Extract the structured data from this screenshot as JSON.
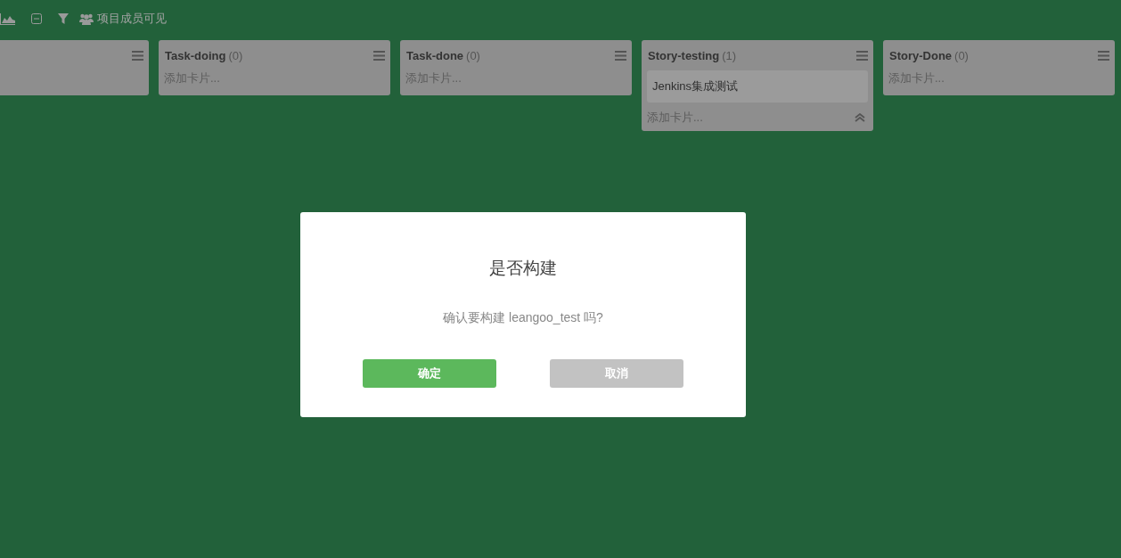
{
  "toolbar": {
    "visibility_label": "项目成员可见"
  },
  "lists": [
    {
      "kind": "cut"
    },
    {
      "kind": "list",
      "title": "Task-doing",
      "count": "(0)",
      "add_card": "添加卡片..."
    },
    {
      "kind": "list",
      "title": "Task-done",
      "count": "(0)",
      "add_card": "添加卡片..."
    },
    {
      "kind": "list",
      "title": "Story-testing",
      "count": "(1)",
      "cards": [
        "Jenkins集成测试"
      ],
      "add_card": "添加卡片...",
      "collapsible": true
    },
    {
      "kind": "list",
      "title": "Story-Done",
      "count": "(0)",
      "add_card": "添加卡片..."
    }
  ],
  "dialog": {
    "title": "是否构建",
    "message": "确认要构建 leangoo_test 吗?",
    "buttons": [
      {
        "label": "确定",
        "kind": "primary"
      },
      {
        "label": "取消",
        "kind": "secondary"
      }
    ]
  }
}
